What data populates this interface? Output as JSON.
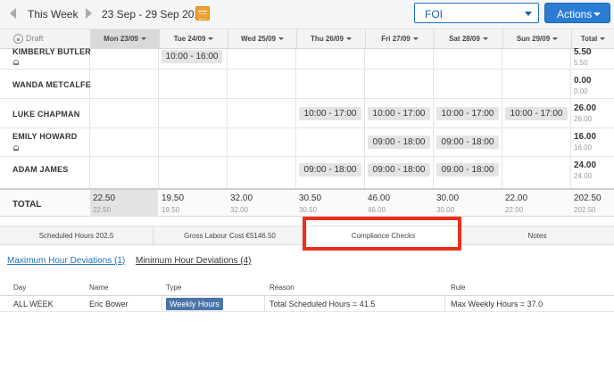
{
  "toolbar": {
    "period_label": "This Week",
    "date_range": "23 Sep - 29 Sep 2019",
    "location_value": "FOI",
    "actions_label": "Actions"
  },
  "grid": {
    "status_label": "Draft",
    "columns": [
      "Mon 23/09",
      "Tue 24/09",
      "Wed 25/09",
      "Thu 26/09",
      "Fri 27/09",
      "Sat 28/09",
      "Sun 29/09",
      "Total"
    ],
    "employees": [
      {
        "name": "KIMBERLY BUTLER",
        "total": "5.50",
        "total_sub": "5.50",
        "shifts": [
          "",
          "10:00 - 16:00",
          "",
          "",
          "",
          "",
          ""
        ]
      },
      {
        "name": "WANDA METCALFE",
        "total": "0.00",
        "total_sub": "0.00",
        "shifts": [
          "",
          "",
          "",
          "",
          "",
          "",
          ""
        ]
      },
      {
        "name": "LUKE CHAPMAN",
        "total": "26.00",
        "total_sub": "26.00",
        "shifts": [
          "",
          "",
          "",
          "10:00 - 17:00",
          "10:00 - 17:00",
          "10:00 - 17:00",
          "10:00 - 17:00"
        ]
      },
      {
        "name": "EMILY HOWARD",
        "total": "16.00",
        "total_sub": "16.00",
        "shifts": [
          "",
          "",
          "",
          "",
          "09:00 - 18:00",
          "09:00 - 18:00",
          ""
        ]
      },
      {
        "name": "ADAM JAMES",
        "total": "24.00",
        "total_sub": "24.00",
        "shifts": [
          "",
          "",
          "",
          "09:00 - 18:00",
          "09:00 - 18:00",
          "09:00 - 18:00",
          ""
        ]
      }
    ],
    "totals_label": "TOTAL",
    "day_totals": [
      "22.50",
      "19.50",
      "32.00",
      "30.50",
      "46.00",
      "30.00",
      "22.00",
      "202.50"
    ],
    "day_totals_sub": [
      "22.50",
      "19.50",
      "32.00",
      "30.50",
      "46.00",
      "30.00",
      "22.00",
      "202.50"
    ]
  },
  "bottom_tabs": [
    "Scheduled Hours 202.5",
    "Gross Labour Cost €5146.50",
    "Compliance Checks",
    "Notes"
  ],
  "compliance": {
    "sub_tabs": [
      "Maximum Hour Deviations (1)",
      "Minimum Hour Deviations (4)"
    ],
    "headers": [
      "Day",
      "Name",
      "Type",
      "Reason",
      "Rule"
    ],
    "row": {
      "day": "ALL WEEK",
      "name": "Eric Bower",
      "type": "Weekly Hours",
      "reason": "Total Scheduled Hours = 41.5",
      "rule": "Max Weekly Hours = 37.0"
    }
  },
  "colors": {
    "accent": "#2b7cd3",
    "highlight": "#e8301c",
    "badge": "#4a74a8"
  }
}
